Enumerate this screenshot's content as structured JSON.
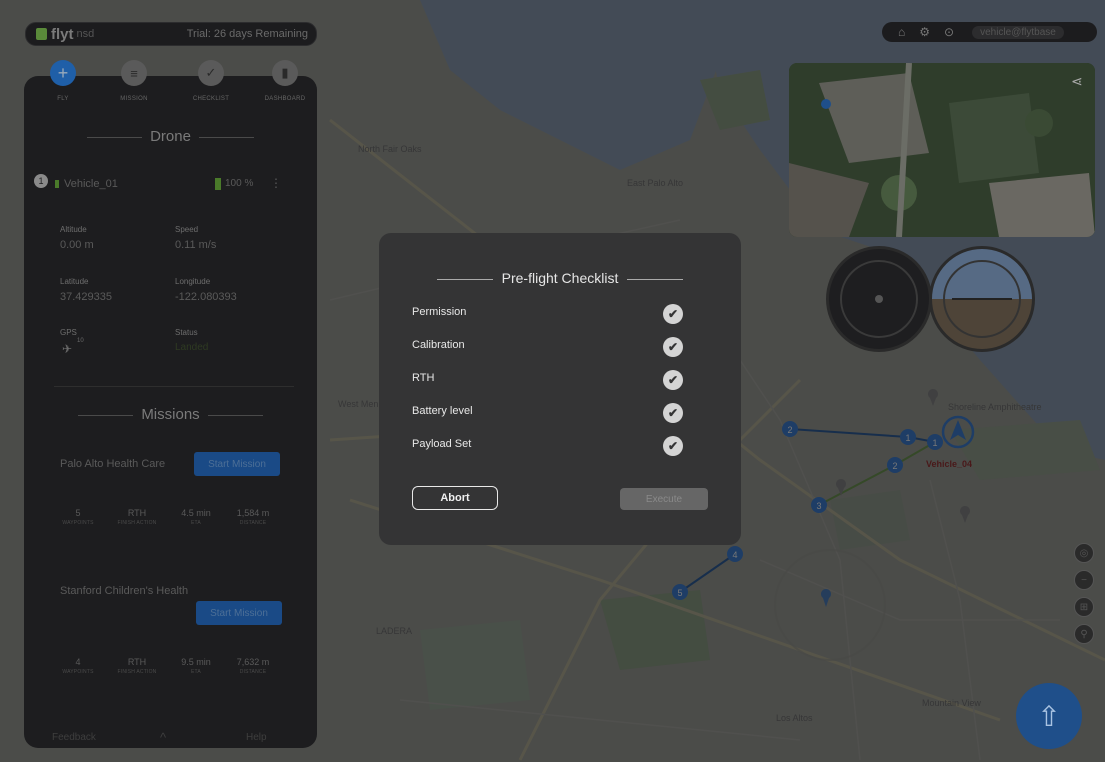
{
  "app": {
    "logo_text": "flyt",
    "logo_sub": "nsd",
    "trial_text": "Trial: 26 days Remaining"
  },
  "topright": {
    "home_icon": "home-icon",
    "gear_icon": "gear-icon",
    "user_icon": "user-icon",
    "user_label": "vehicle@flytbase"
  },
  "panel": {
    "tabs": [
      {
        "label": "FLY",
        "icon": "+"
      },
      {
        "label": "MISSION",
        "icon": "≡"
      },
      {
        "label": "CHECKLIST",
        "icon": "✓"
      },
      {
        "label": "DASHBOARD",
        "icon": "▮"
      }
    ],
    "drone_title": "Drone",
    "vehicle": {
      "index": "1",
      "name": "Vehicle_01",
      "battery": "100 %",
      "menu": "⋮"
    },
    "fields": {
      "altitude_label": "Altitude",
      "altitude_value": "0.00 m",
      "speed_label": "Speed",
      "speed_value": "0.11 m/s",
      "latitude_label": "Latitude",
      "latitude_value": "37.429335",
      "longitude_label": "Longitude",
      "longitude_value": "-122.080393",
      "gps_label": "GPS",
      "gps_value": "10",
      "status_label": "Status",
      "status_value": "Landed"
    },
    "missions_title": "Missions",
    "missions": [
      {
        "name": "Palo Alto Health Care",
        "start_label": "Start Mission",
        "stats": [
          {
            "value": "5",
            "label": "WAYPOINTS"
          },
          {
            "value": "RTH",
            "label": "FINISH ACTION"
          },
          {
            "value": "4.5 min",
            "label": "ETA"
          },
          {
            "value": "1,584 m",
            "label": "DISTANCE"
          }
        ]
      },
      {
        "name": "Stanford Children's Health",
        "start_label": "Start Mission",
        "stats": [
          {
            "value": "4",
            "label": "WAYPOINTS"
          },
          {
            "value": "RTH",
            "label": "FINISH ACTION"
          },
          {
            "value": "9.5 min",
            "label": "ETA"
          },
          {
            "value": "7,632 m",
            "label": "DISTANCE"
          }
        ]
      }
    ],
    "footer": {
      "feedback": "Feedback",
      "chevron": "^",
      "help": "Help"
    }
  },
  "modal": {
    "title": "Pre-flight Checklist",
    "items": [
      {
        "label": "Permission",
        "checked": true
      },
      {
        "label": "Calibration",
        "checked": true
      },
      {
        "label": "RTH",
        "checked": true
      },
      {
        "label": "Battery level",
        "checked": true
      },
      {
        "label": "Payload Set",
        "checked": true
      }
    ],
    "abort_label": "Abort",
    "execute_label": "Execute"
  },
  "map": {
    "labels": {
      "north_fair_oaks": "North Fair Oaks",
      "east_palo_alto": "East Palo Alto",
      "west_menlo_park": "West Menlo Park",
      "mountain_view": "Mountain View",
      "los_altos": "Los Altos",
      "shoreline_amphitheatre": "Shoreline Amphitheatre",
      "ladera": "LADERA",
      "vehicle_04": "Vehicle_04"
    },
    "waypoints": [
      "1",
      "2",
      "3",
      "4",
      "5"
    ]
  },
  "colors": {
    "accent": "#1f5fa8",
    "waypoint": "#2a6fc7",
    "route_green": "#6ab04c"
  }
}
